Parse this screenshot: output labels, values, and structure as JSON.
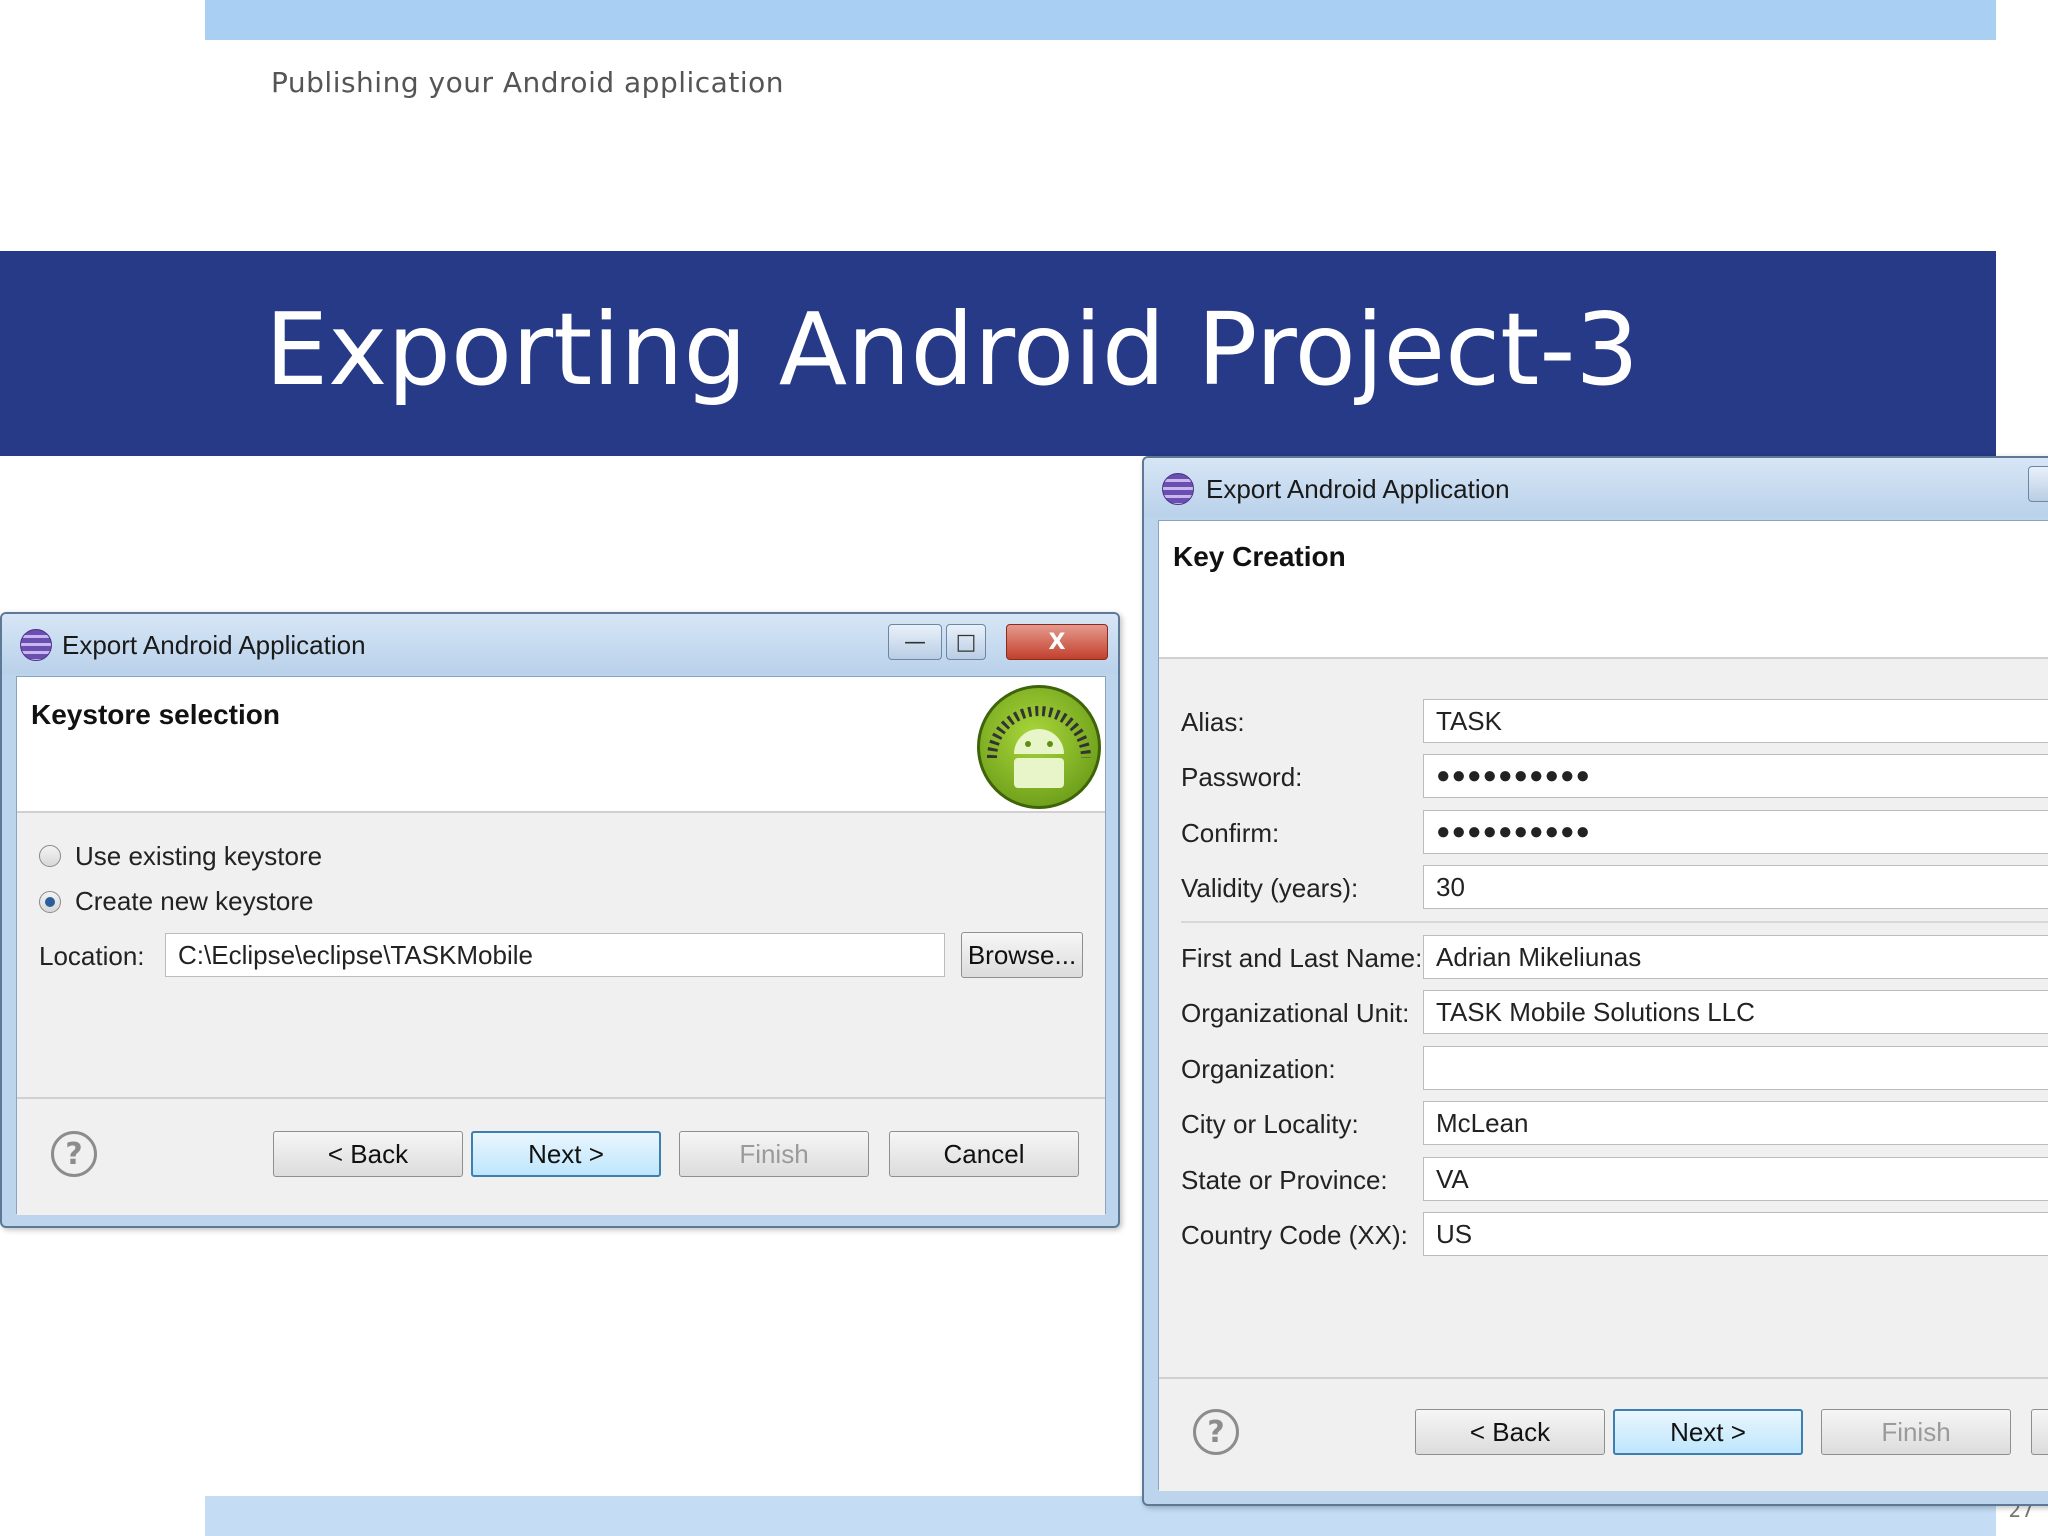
{
  "slide": {
    "subtitle": "Publishing your Android application",
    "title": "Exporting Android Project-3",
    "page_number": "27"
  },
  "dialog1": {
    "window_title": "Export Android Application",
    "window_controls": {
      "minimize": "—",
      "maximize": "□",
      "close": "X"
    },
    "header_title": "Keystore selection",
    "options": [
      {
        "label": "Use existing keystore",
        "selected": false
      },
      {
        "label": "Create new keystore",
        "selected": true
      }
    ],
    "location_label": "Location:",
    "location_value": "C:\\Eclipse\\eclipse\\TASKMobile",
    "browse_label": "Browse...",
    "help_glyph": "?",
    "buttons": {
      "back": "< Back",
      "next": "Next >",
      "finish": "Finish",
      "cancel": "Cancel"
    }
  },
  "dialog2": {
    "window_title": "Export Android Application",
    "header_title": "Key Creation",
    "fields": [
      {
        "label": "Alias:",
        "value": "TASK"
      },
      {
        "label": "Password:",
        "value": "●●●●●●●●●●"
      },
      {
        "label": "Confirm:",
        "value": "●●●●●●●●●●"
      },
      {
        "label": "Validity (years):",
        "value": "30"
      },
      {
        "label": "First and Last Name:",
        "value": "Adrian Mikeliunas"
      },
      {
        "label": "Organizational Unit:",
        "value": "TASK Mobile Solutions LLC"
      },
      {
        "label": "Organization:",
        "value": ""
      },
      {
        "label": "City or Locality:",
        "value": "McLean"
      },
      {
        "label": "State or Province:",
        "value": "VA"
      },
      {
        "label": "Country Code (XX):",
        "value": "US"
      }
    ],
    "help_glyph": "?",
    "buttons": {
      "back": "< Back",
      "next": "Next >",
      "finish": "Finish"
    }
  }
}
